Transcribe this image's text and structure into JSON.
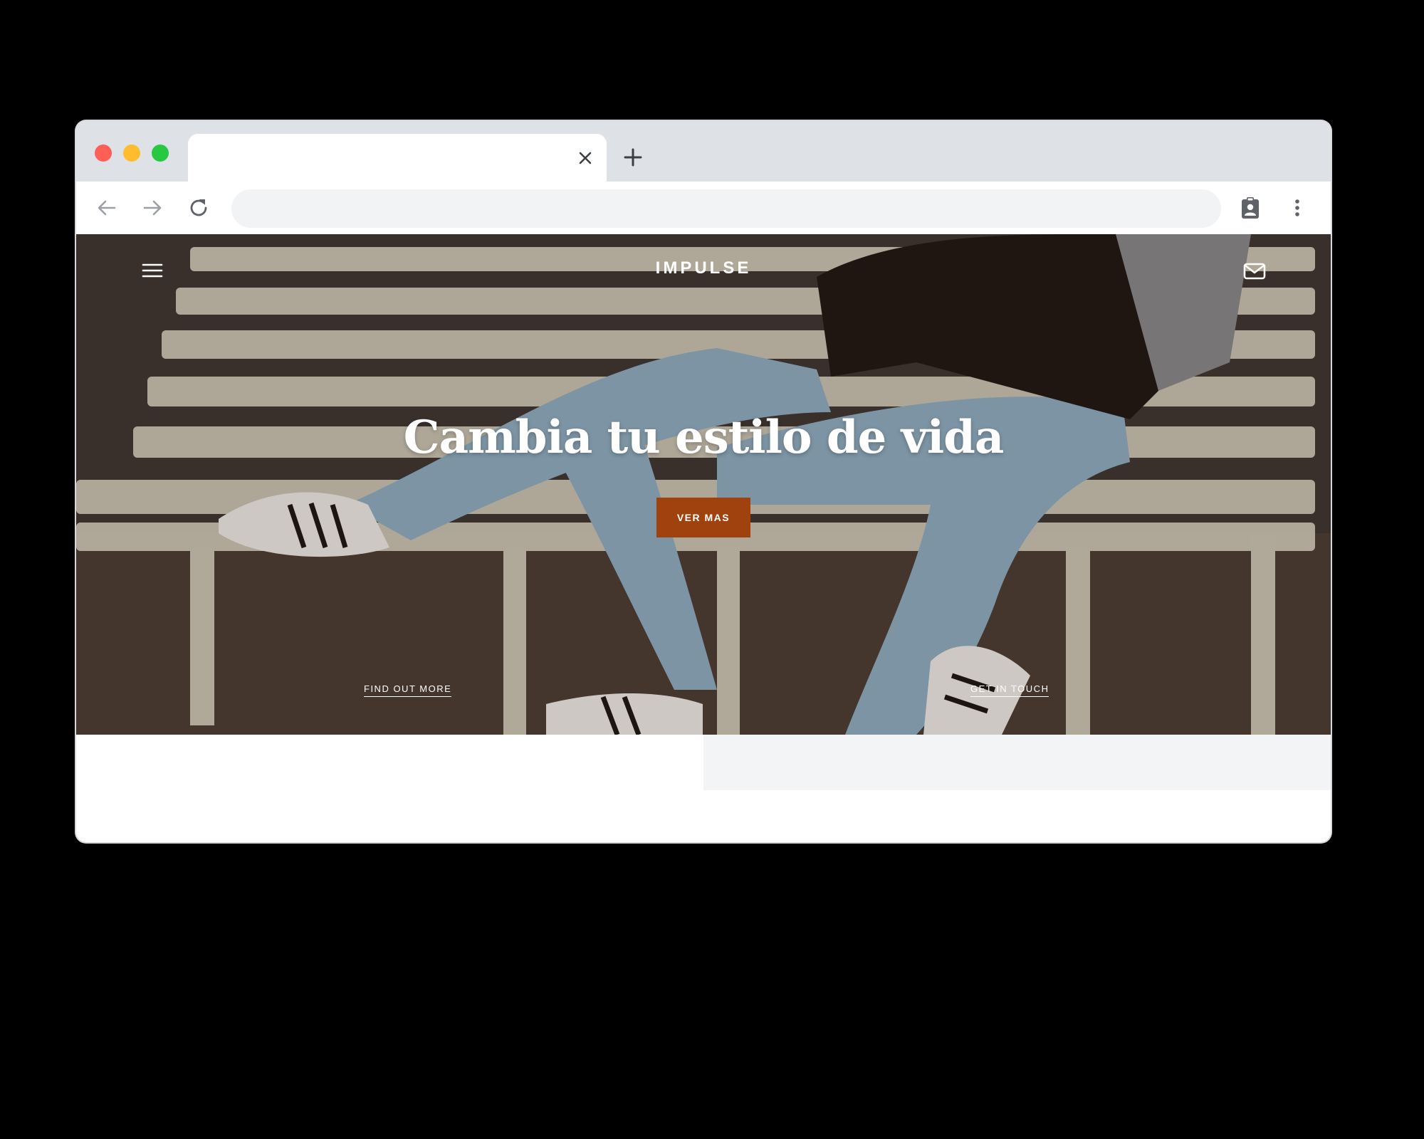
{
  "browser": {
    "tab": {
      "title": ""
    },
    "address_bar": {
      "value": "",
      "placeholder": ""
    },
    "icons": {
      "back": "arrow-left-icon",
      "forward": "arrow-right-icon",
      "reload": "reload-icon",
      "profile": "clipboard-account-icon",
      "menu": "kebab-menu-icon",
      "close_tab": "close-icon",
      "new_tab": "plus-icon"
    },
    "colors": {
      "tabstrip": "#dee1e6",
      "omnibox": "#f1f3f4",
      "traffic_red": "#fe5f57",
      "traffic_yellow": "#febc2e",
      "traffic_green": "#28c840"
    }
  },
  "site": {
    "logo": "IMPULSE",
    "hero": {
      "title": "Cambia tu estilo de vida",
      "cta_label": "VER MAS",
      "links": {
        "left": "FIND OUT MORE",
        "right": "GET IN TOUCH"
      }
    },
    "colors": {
      "cta": "#a0420e",
      "text": "#ffffff"
    }
  }
}
